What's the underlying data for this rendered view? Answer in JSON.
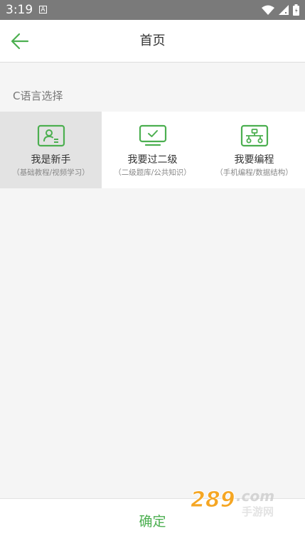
{
  "status_bar": {
    "time": "3:19",
    "notification_icon": "A",
    "icons": [
      "wifi-icon",
      "signal-icon",
      "battery-icon"
    ]
  },
  "header": {
    "title": "首页",
    "back_icon": "arrow-left-icon"
  },
  "section": {
    "title": "C语言选择"
  },
  "options": [
    {
      "title": "我是新手",
      "subtitle": "（基础教程/视频学习）",
      "icon": "user-card-icon",
      "selected": true
    },
    {
      "title": "我要过二级",
      "subtitle": "（二级题库/公共知识）",
      "icon": "monitor-check-icon",
      "selected": false
    },
    {
      "title": "我要编程",
      "subtitle": "（手机编程/数据结构）",
      "icon": "network-icon",
      "selected": false
    }
  ],
  "footer": {
    "confirm_label": "确定"
  },
  "watermark": {
    "logo_text": "289.com 手游网"
  },
  "colors": {
    "accent": "#4caf50",
    "status_bar": "#7a7a7a",
    "selected_bg": "#e3e3e3",
    "page_bg": "#f5f5f5"
  }
}
